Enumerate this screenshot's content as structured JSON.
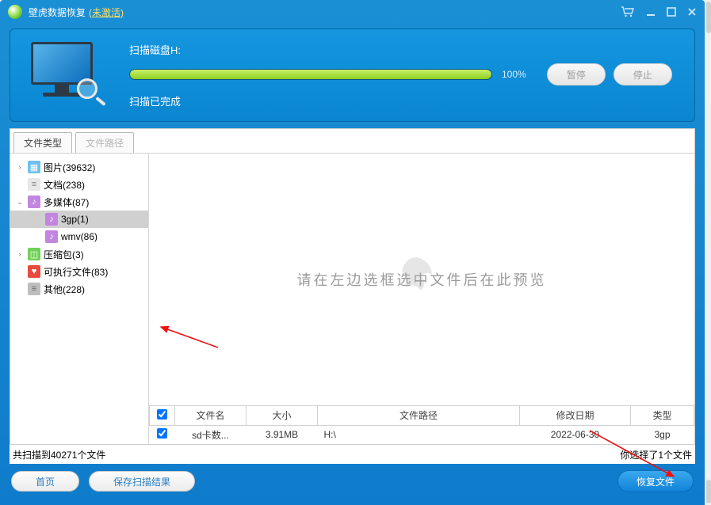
{
  "titlebar": {
    "app_name": "壁虎数据恢复",
    "unactivated": "(未激活)"
  },
  "scan": {
    "label": "扫描磁盘H:",
    "percent": "100%",
    "done_label": "扫描已完成",
    "pause": "暂停",
    "stop": "停止"
  },
  "tabs": {
    "filetype": "文件类型",
    "filepath": "文件路径"
  },
  "tree": [
    {
      "depth": 1,
      "arrow": "›",
      "icon": "pic",
      "label": "图片(39632)",
      "interact": true
    },
    {
      "depth": 1,
      "arrow": "",
      "icon": "doc",
      "label": "文档(238)",
      "interact": true
    },
    {
      "depth": 1,
      "arrow": "v",
      "icon": "media",
      "label": "多媒体(87)",
      "interact": true
    },
    {
      "depth": 2,
      "arrow": "",
      "icon": "media",
      "label": "3gp(1)",
      "interact": true,
      "selected": true
    },
    {
      "depth": 2,
      "arrow": "",
      "icon": "media",
      "label": "wmv(86)",
      "interact": true
    },
    {
      "depth": 1,
      "arrow": "›",
      "icon": "zip",
      "label": "压缩包(3)",
      "interact": true
    },
    {
      "depth": 1,
      "arrow": "",
      "icon": "exe",
      "label": "可执行文件(83)",
      "interact": true
    },
    {
      "depth": 1,
      "arrow": "",
      "icon": "other",
      "label": "其他(228)",
      "interact": true
    }
  ],
  "preview_hint": "请在左边选框选中文件后在此预览",
  "table": {
    "cols": {
      "name": "文件名",
      "size": "大小",
      "path": "文件路径",
      "date": "修改日期",
      "type": "类型"
    },
    "rows": [
      {
        "name": "sd卡数...",
        "size": "3.91MB",
        "path": "H:\\",
        "date": "2022-06-30",
        "type": "3gp"
      }
    ]
  },
  "status": {
    "left": "共扫描到40271个文件",
    "right": "你选择了1个文件"
  },
  "buttons": {
    "home": "首页",
    "save_scan": "保存扫描结果",
    "recover": "恢复文件"
  }
}
